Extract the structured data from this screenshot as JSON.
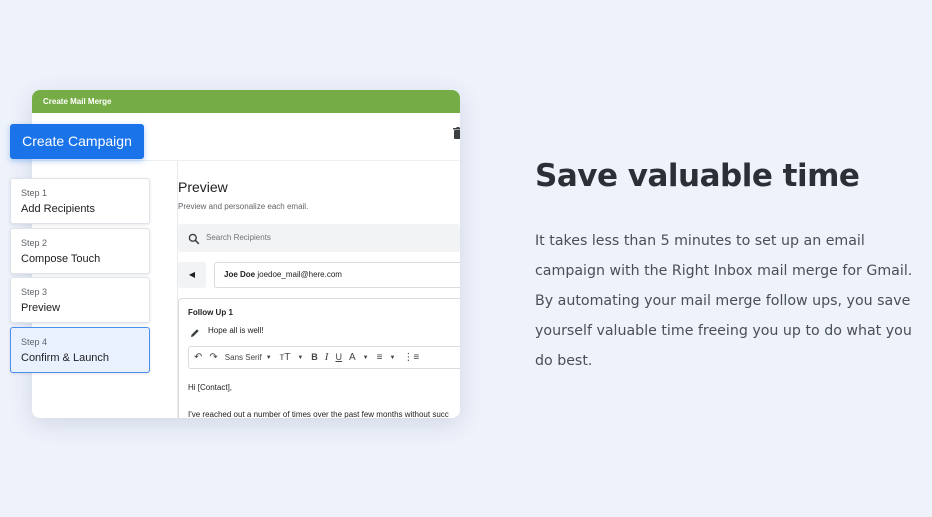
{
  "mockup": {
    "window_title": "Create Mail Merge",
    "preview_title": "Preview",
    "preview_subtitle": "Preview and personalize each email.",
    "search_placeholder": "Search Recipients",
    "contact_name": "Joe Doe",
    "contact_email": "joedoe_mail@here.com",
    "followup_label": "Follow Up 1",
    "subject_text": "Hope all is well!",
    "font_name": "Sans Serif",
    "body_greeting": "Hi [Contact],",
    "body_text": "I've reached out a number of times over the past few months without succ"
  },
  "create_button": "Create Campaign",
  "steps": [
    {
      "num": "Step 1",
      "name": "Add Recipients"
    },
    {
      "num": "Step 2",
      "name": "Compose Touch"
    },
    {
      "num": "Step 3",
      "name": "Preview"
    },
    {
      "num": "Step 4",
      "name": "Confirm & Launch"
    }
  ],
  "active_step": 4,
  "headline": "Save valuable time",
  "paragraph": "It takes less than 5 minutes to set up an email campaign with the Right Inbox mail merge for Gmail. By automating your mail merge follow ups, you save yourself valuable time freeing you up to do what you do best.",
  "colors": {
    "background": "#eef2fb",
    "header_green": "#76ac45",
    "accent_blue": "#1a73e8",
    "active_step_bg": "#e9f1fe"
  },
  "icons": [
    "trash-icon",
    "search-icon",
    "back-arrow-icon",
    "pencil-icon",
    "undo-icon",
    "redo-icon",
    "text-size-icon",
    "bold-icon",
    "italic-icon",
    "underline-icon",
    "text-color-icon",
    "align-icon",
    "numbered-list-icon"
  ]
}
